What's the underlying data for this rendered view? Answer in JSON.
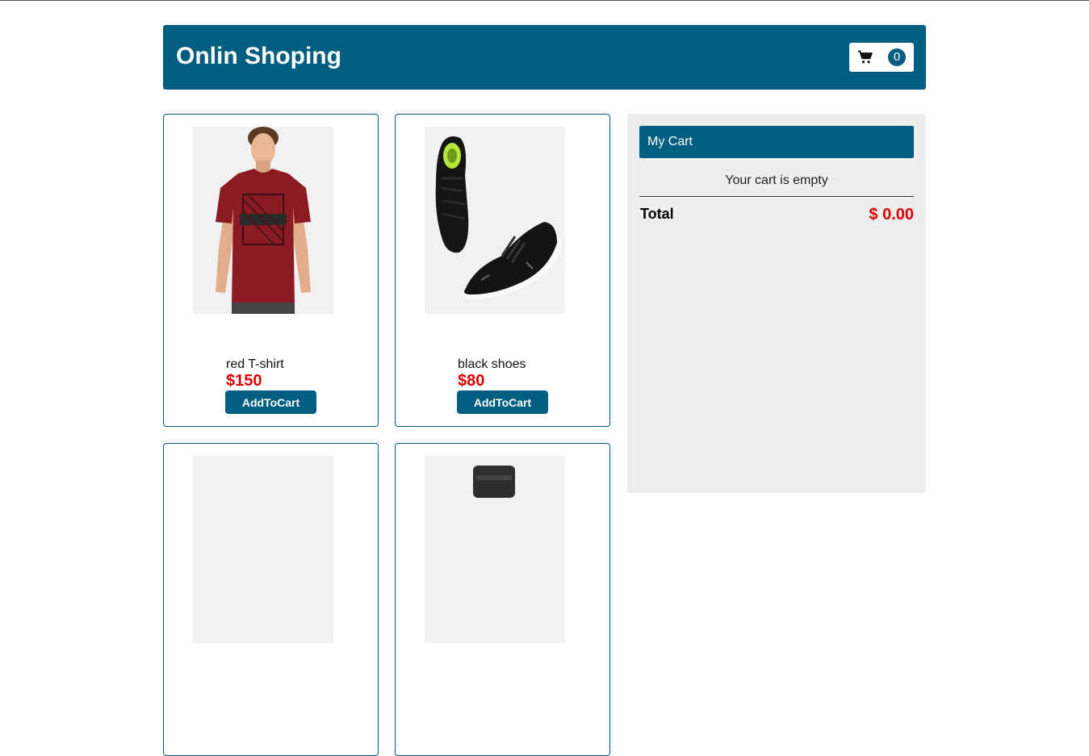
{
  "header": {
    "title": "Onlin Shoping",
    "cart_count": "0"
  },
  "products": [
    {
      "name": "red T-shirt",
      "price": "$150",
      "button": "AddToCart",
      "shirt_color": "#8b1a22"
    },
    {
      "name": "black shoes",
      "price": "$80",
      "button": "AddToCart"
    },
    {
      "name": "",
      "price": "",
      "button": ""
    },
    {
      "name": "",
      "price": "",
      "button": ""
    }
  ],
  "cart": {
    "heading": "My Cart",
    "empty_text": "Your cart is empty",
    "total_label": "Total",
    "total_value": "$ 0.00"
  },
  "colors": {
    "brand": "#015e80",
    "price": "#e00000",
    "panel": "#eeeeee"
  }
}
